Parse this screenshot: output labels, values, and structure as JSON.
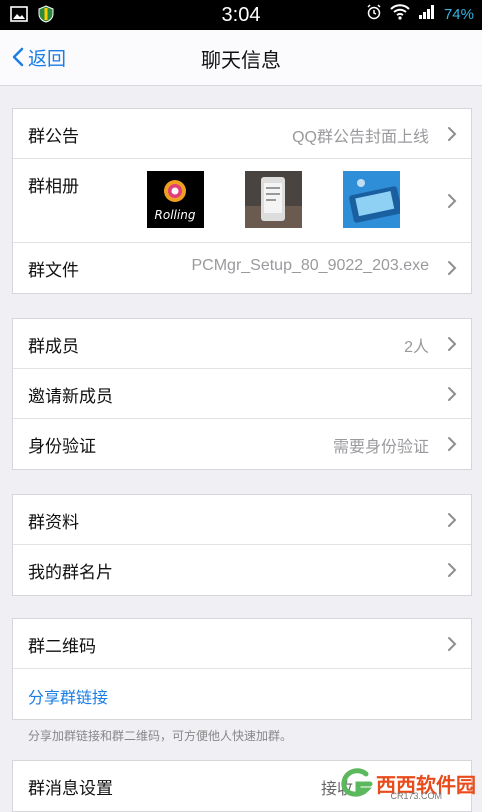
{
  "statusbar": {
    "time": "3:04",
    "battery": "74%"
  },
  "navbar": {
    "back_label": "返回",
    "title": "聊天信息"
  },
  "groups": [
    {
      "rows": [
        {
          "label": "群公告",
          "value": "QQ群公告封面上线"
        },
        {
          "label": "群相册",
          "thumbs": [
            "Rolling",
            "phone-photo",
            "phone-screenshot"
          ]
        },
        {
          "label": "群文件",
          "value": "PCMgr_Setup_80_9022_203.exe"
        }
      ]
    },
    {
      "rows": [
        {
          "label": "群成员",
          "value": "2人"
        },
        {
          "label": "邀请新成员",
          "value": ""
        },
        {
          "label": "身份验证",
          "value": "需要身份验证"
        }
      ]
    },
    {
      "rows": [
        {
          "label": "群资料",
          "value": ""
        },
        {
          "label": "我的群名片",
          "value": ""
        }
      ]
    },
    {
      "rows": [
        {
          "label": "群二维码",
          "value": ""
        },
        {
          "label": "分享群链接",
          "value": ""
        }
      ]
    },
    {
      "rows": [
        {
          "label": "群消息设置",
          "value": "接收"
        }
      ]
    }
  ],
  "hint": "分享加群链接和群二维码，可方便他人快速加群。",
  "watermark": {
    "brand": "西西软件园",
    "sub": "CR173.COM"
  },
  "colors": {
    "accent": "#1a7ee5",
    "battery": "#33b5e5",
    "background": "#efeff4"
  }
}
